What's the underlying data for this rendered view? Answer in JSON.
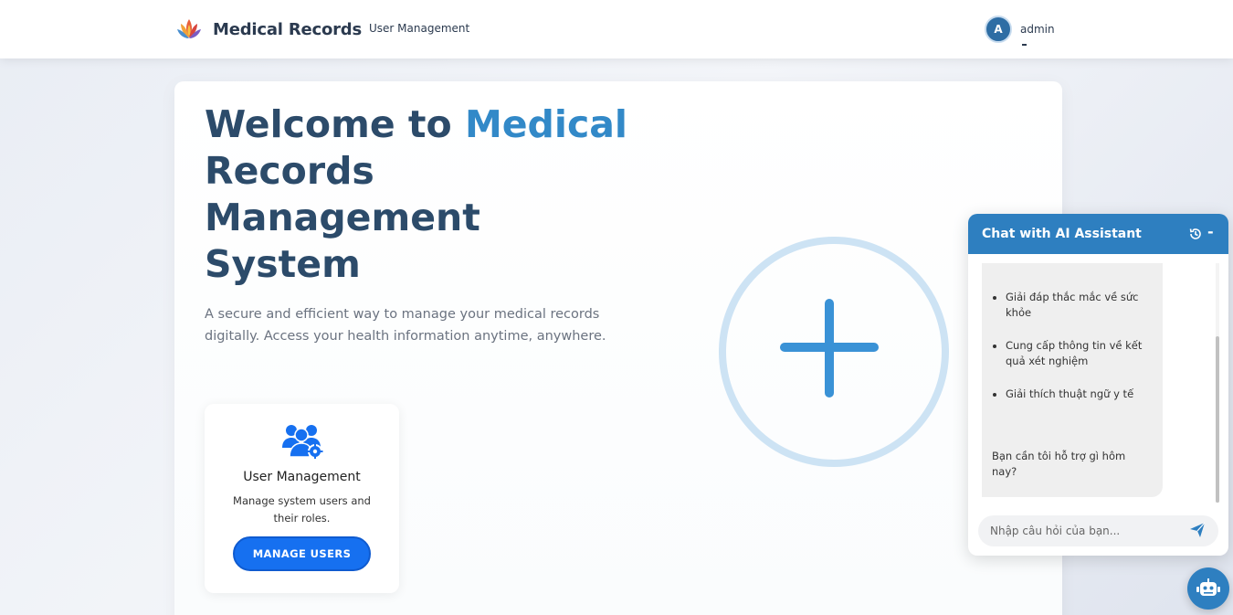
{
  "navbar": {
    "brand": "Medical Records",
    "link": "User Management",
    "user_initial": "A",
    "username": "admin"
  },
  "hero": {
    "title_part1": "Welcome to ",
    "title_accent": "Medical",
    "title_part2": "Records Management System",
    "description": "A secure and efficient way to manage your medical records digitally. Access your health information anytime, anywhere."
  },
  "feature": {
    "icon": "users-gear-icon",
    "title": "User Management",
    "description": "Manage system users and their roles.",
    "button": "MANAGE USERS"
  },
  "chat": {
    "title": "Chat with AI Assistant",
    "items": [
      "Giải đáp thắc mắc về sức khỏe",
      "Cung cấp thông tin về kết quả xét nghiệm",
      "Giải thích thuật ngữ y tế"
    ],
    "closing": "Bạn cần tôi hỗ trợ gì hôm nay?",
    "input_placeholder": "Nhập câu hỏi của bạn..."
  },
  "colors": {
    "primary": "#2e7fc0",
    "accent": "#3289c8",
    "button": "#1670f0",
    "title": "#2c4b6a"
  }
}
